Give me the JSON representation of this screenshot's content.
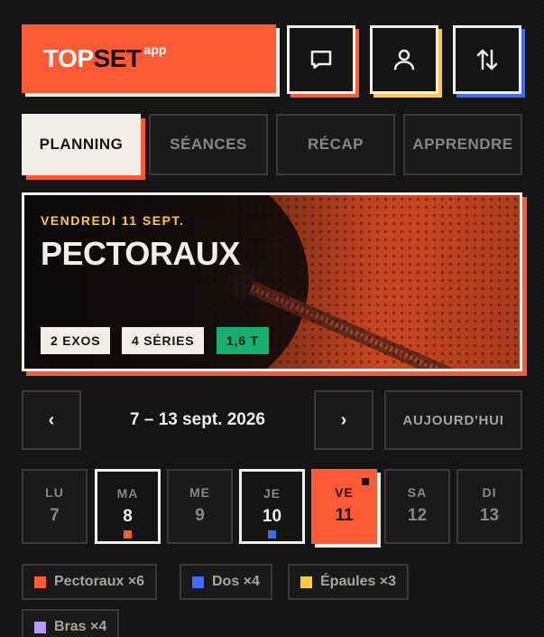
{
  "header": {
    "logo_top": "TOP",
    "logo_set": "SET",
    "logo_app": "app",
    "icons": [
      "chat-icon",
      "user-icon",
      "sort-arrows-icon"
    ],
    "accent_colors": {
      "chat": "#ff5a36",
      "user": "#ffc93c",
      "sort": "#3d6bff"
    }
  },
  "tabs": [
    "PLANNING",
    "SÉANCES",
    "RÉCAP",
    "APPRENDRE"
  ],
  "active_tab": "PLANNING",
  "hero": {
    "date": "VENDREDI 11 SEPT.",
    "title": "PECTORAUX",
    "chips": [
      "2 EXOS",
      "4 SÉRIES",
      "1,6 T"
    ]
  },
  "week": {
    "prev": "‹",
    "range": "7 – 13 sept. 2026",
    "next": "›",
    "today_label": "AUJOURD'HUI"
  },
  "days": [
    {
      "name": "LU",
      "num": "7"
    },
    {
      "name": "MA",
      "num": "8",
      "dot": "#ff5a36"
    },
    {
      "name": "ME",
      "num": "9"
    },
    {
      "name": "JE",
      "num": "10",
      "dot": "#3d6bff"
    },
    {
      "name": "VE",
      "num": "11",
      "today": true
    },
    {
      "name": "SA",
      "num": "12"
    },
    {
      "name": "DI",
      "num": "13"
    }
  ],
  "legend": [
    {
      "label": "Pectoraux ×6",
      "color": "#ff5a36"
    },
    {
      "label": "Dos ×4",
      "color": "#3d6bff"
    },
    {
      "label": "Épaules ×3",
      "color": "#ffc93c"
    },
    {
      "label": "Bras ×4",
      "color": "#b89cf0"
    }
  ],
  "colors": {
    "accent": "#ff5a36",
    "background": "#141414",
    "cream": "#f2efe8",
    "green": "#16b06e"
  }
}
